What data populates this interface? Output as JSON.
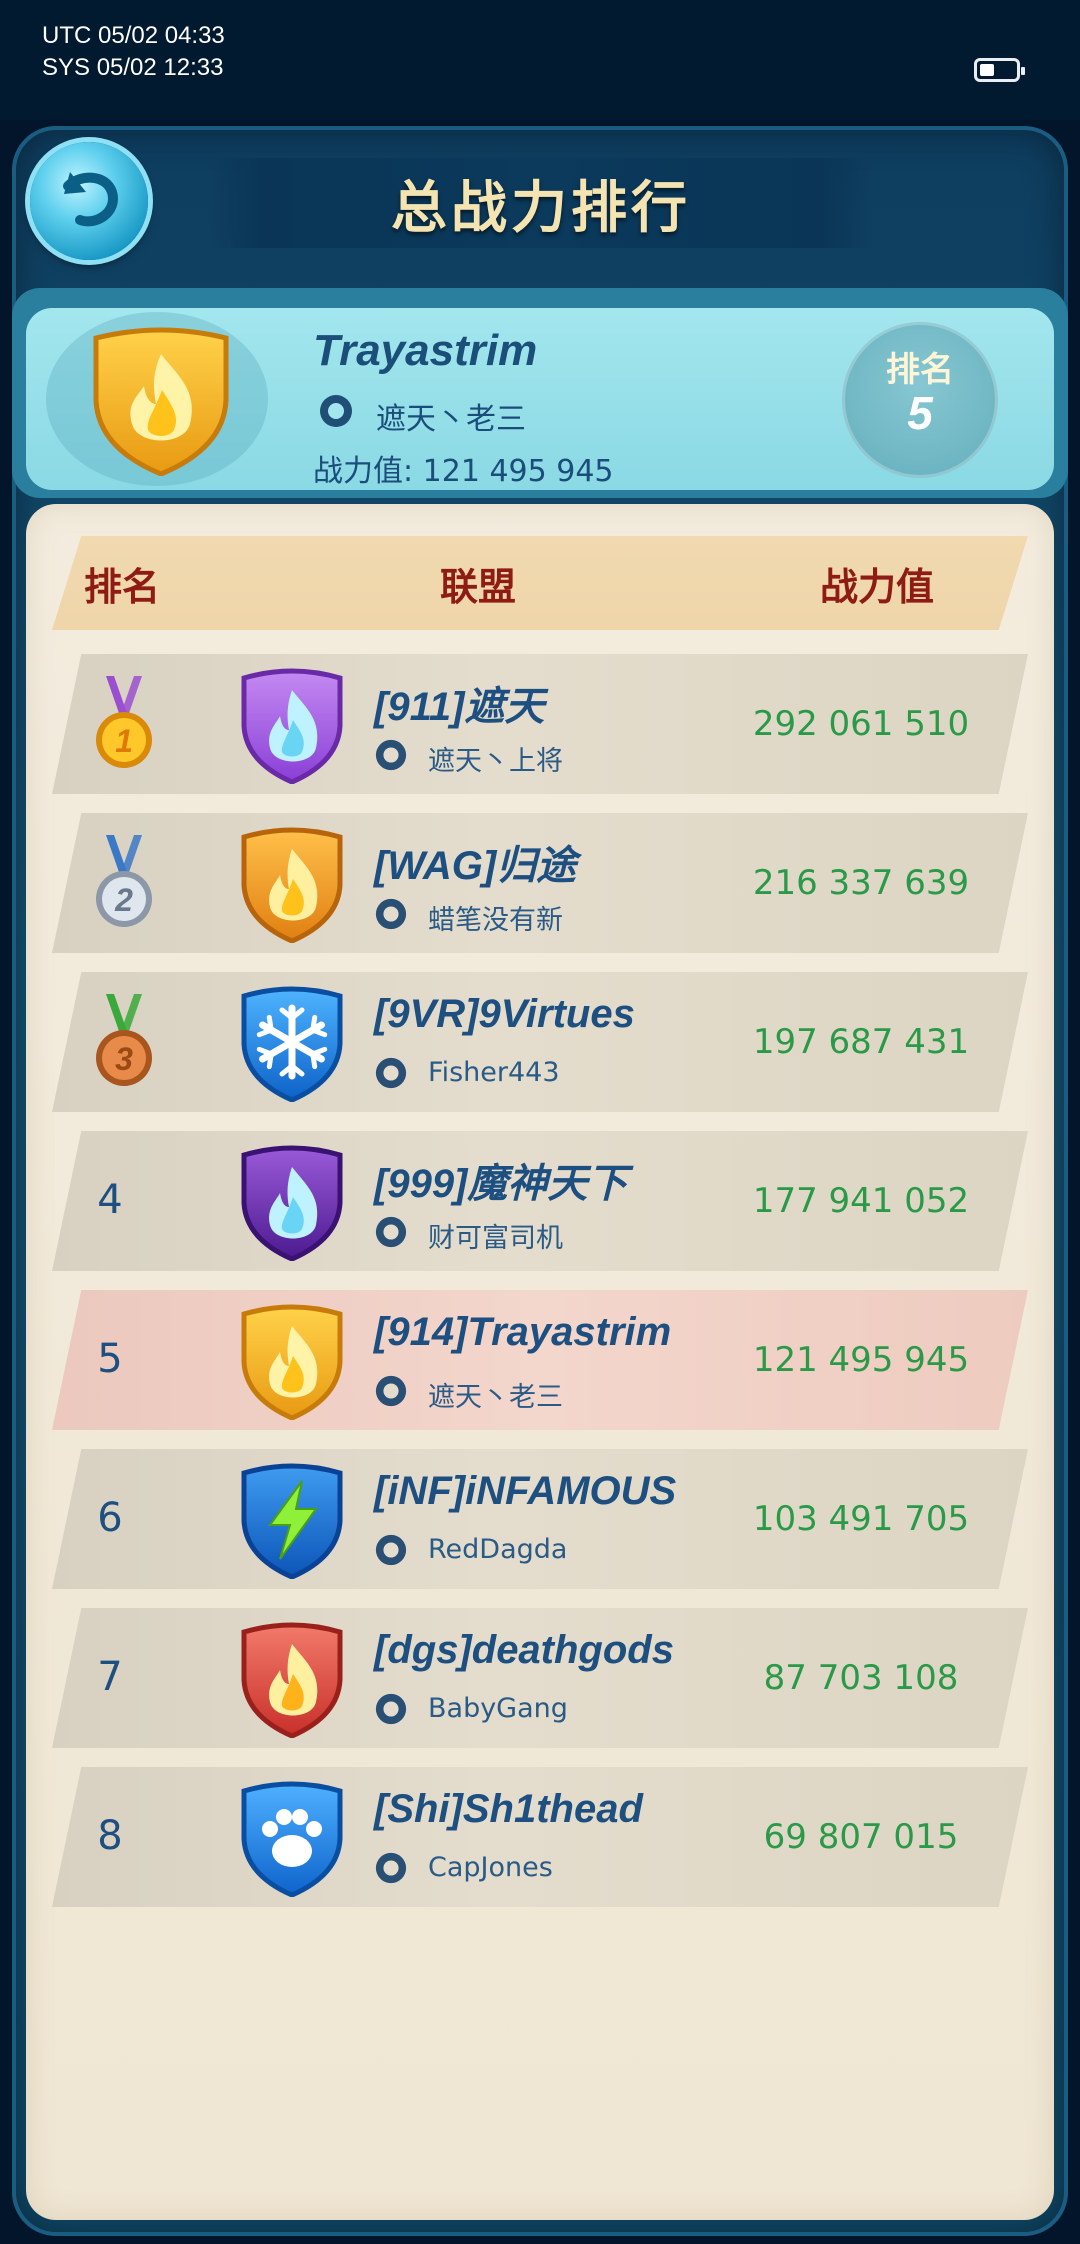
{
  "status_bar": {
    "utc": "UTC 05/02 04:33",
    "sys": "SYS 05/02 12:33",
    "battery_level": 0.4
  },
  "header": {
    "title": "总战力排行",
    "back_icon": "back-arrow-icon"
  },
  "my_rank": {
    "name": "Trayastrim",
    "alliance": "遮天丶老三",
    "power": "战力值: 121 495 945",
    "rank_label": "排名",
    "rank_value": "5",
    "emblem_icon": "flame-shield-icon"
  },
  "table": {
    "headers": {
      "rank": "排名",
      "alliance": "联盟",
      "power": "战力值"
    },
    "rows": [
      {
        "rank": "1",
        "medal": "gold-medal-icon",
        "alliance": "[911]遮天",
        "leader": "遮天丶上将",
        "power": "292 061 510",
        "emblem": "purple-flame-shield-icon"
      },
      {
        "rank": "2",
        "medal": "silver-medal-icon",
        "alliance": "[WAG]归途",
        "leader": "蜡笔没有新",
        "power": "216 337 639",
        "emblem": "orange-flame-shield-icon"
      },
      {
        "rank": "3",
        "medal": "bronze-medal-icon",
        "alliance": "[9VR]9Virtues",
        "leader": "Fisher443",
        "power": "197 687 431",
        "emblem": "snowflake-shield-icon"
      },
      {
        "rank": "4",
        "alliance": "[999]魔神天下",
        "leader": "财可富司机",
        "power": "177 941 052",
        "emblem": "dark-purple-flame-shield-icon"
      },
      {
        "rank": "5",
        "alliance": "[914]Trayastrim",
        "leader": "遮天丶老三",
        "power": "121 495 945",
        "emblem": "gold-flame-shield-icon",
        "highlight": true
      },
      {
        "rank": "6",
        "alliance": "[iNF]iNFAMOUS",
        "leader": "RedDagda",
        "power": "103 491 705",
        "emblem": "lightning-shield-icon"
      },
      {
        "rank": "7",
        "alliance": "[dgs]deathgods",
        "leader": "BabyGang",
        "power": "87 703 108",
        "emblem": "red-flame-shield-icon"
      },
      {
        "rank": "8",
        "alliance": "[Shi]Sh1thead",
        "leader": "CapJones",
        "power": "69 807 015",
        "emblem": "paw-shield-icon"
      }
    ]
  },
  "colors": {
    "rank_text": "#1d4f80",
    "header_text": "#8e1c14",
    "power_text": "#2a9a48",
    "highlight_row": "#f3d6cc"
  }
}
